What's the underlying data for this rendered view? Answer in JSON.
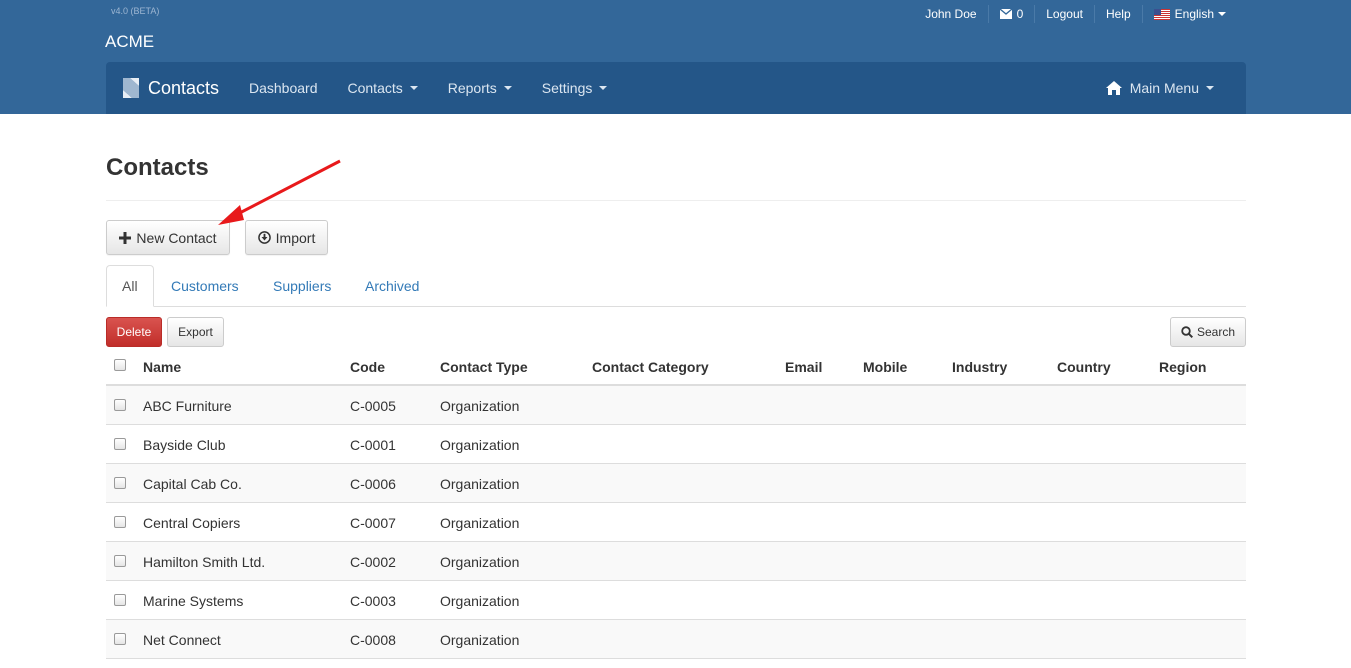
{
  "header": {
    "version": "v4.0 (BETA)",
    "brand": "ACME",
    "user": "John Doe",
    "messages_count": "0",
    "logout": "Logout",
    "help": "Help",
    "language": "English"
  },
  "navbar": {
    "brand": "Contacts",
    "links": [
      {
        "label": "Dashboard",
        "dropdown": false
      },
      {
        "label": "Contacts",
        "dropdown": true
      },
      {
        "label": "Reports",
        "dropdown": true
      },
      {
        "label": "Settings",
        "dropdown": true
      }
    ],
    "main_menu": "Main Menu"
  },
  "page": {
    "title": "Contacts",
    "new_contact": "New Contact",
    "import": "Import"
  },
  "tabs": [
    "All",
    "Customers",
    "Suppliers",
    "Archived"
  ],
  "actions": {
    "delete": "Delete",
    "export": "Export",
    "search": "Search"
  },
  "table": {
    "columns": [
      "Name",
      "Code",
      "Contact Type",
      "Contact Category",
      "Email",
      "Mobile",
      "Industry",
      "Country",
      "Region"
    ],
    "rows": [
      {
        "name": "ABC Furniture",
        "code": "C-0005",
        "type": "Organization"
      },
      {
        "name": "Bayside Club",
        "code": "C-0001",
        "type": "Organization"
      },
      {
        "name": "Capital Cab Co.",
        "code": "C-0006",
        "type": "Organization"
      },
      {
        "name": "Central Copiers",
        "code": "C-0007",
        "type": "Organization"
      },
      {
        "name": "Hamilton Smith Ltd.",
        "code": "C-0002",
        "type": "Organization"
      },
      {
        "name": "Marine Systems",
        "code": "C-0003",
        "type": "Organization"
      },
      {
        "name": "Net Connect",
        "code": "C-0008",
        "type": "Organization"
      }
    ]
  },
  "colors": {
    "header_bg": "#336799",
    "navbar_bg": "#245688",
    "link": "#337ab7",
    "danger": "#d9534f",
    "annotation_arrow": "#e8191b"
  }
}
